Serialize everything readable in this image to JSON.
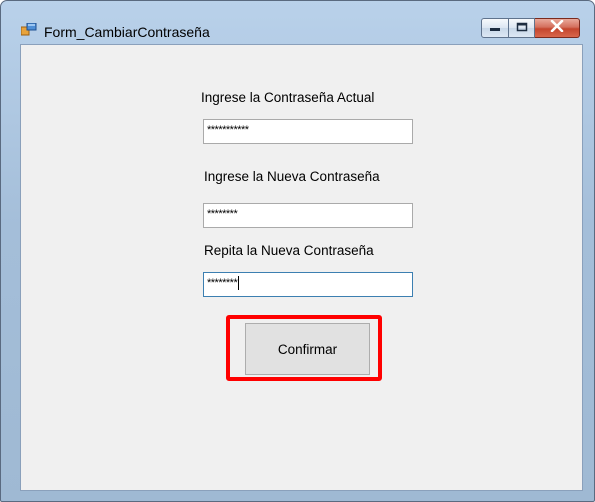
{
  "window": {
    "title": "Form_CambiarContraseña",
    "icon": "windows-form-icon"
  },
  "controls": {
    "minimize_icon": "minimize-icon",
    "maximize_icon": "maximize-icon",
    "close_icon": "close-icon"
  },
  "form": {
    "current_password": {
      "label": "Ingrese la Contraseña Actual",
      "value": "***********"
    },
    "new_password": {
      "label": "Ingrese la Nueva Contraseña",
      "value": "********"
    },
    "repeat_password": {
      "label": "Repita la Nueva Contraseña",
      "value": "********"
    },
    "confirm_label": "Confirmar"
  },
  "colors": {
    "highlight": "#ff0000",
    "client_bg": "#f0f0f0",
    "focused_border": "#3c7fb1"
  }
}
